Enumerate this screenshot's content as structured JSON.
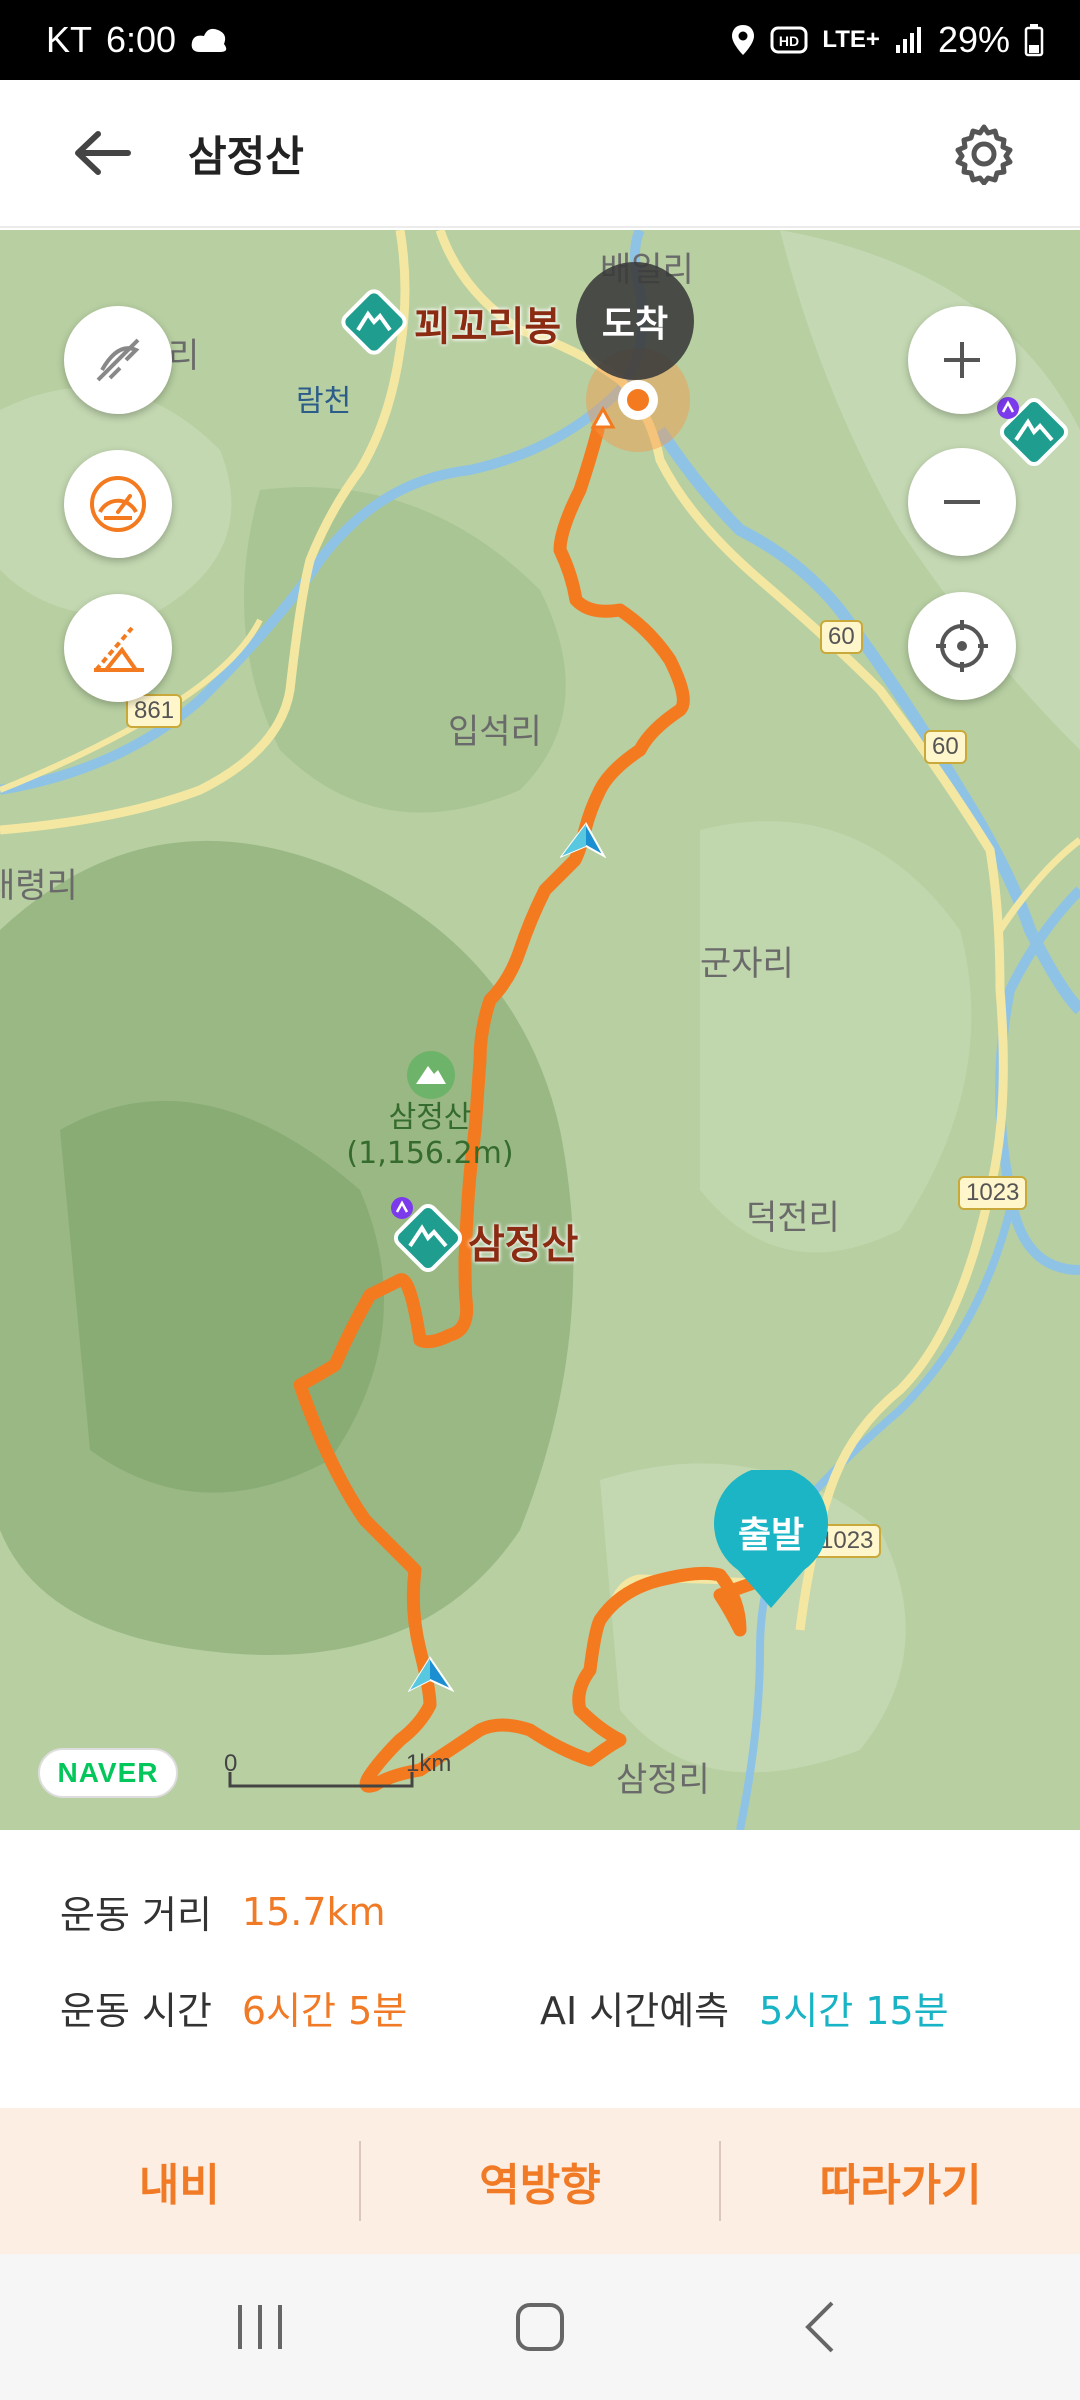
{
  "status_bar": {
    "carrier": "KT",
    "time": "6:00",
    "network": "LTE+",
    "battery": "29%",
    "icons": [
      "cloud-icon",
      "location-icon",
      "hd-icon",
      "lte-icon",
      "signal-icon",
      "battery-icon"
    ]
  },
  "header": {
    "title": "삼정산",
    "back_icon": "back-arrow-icon",
    "settings_icon": "gear-icon"
  },
  "map": {
    "place_labels": [
      "배일리",
      "람천",
      "입석리",
      "군자리",
      "덕전리",
      "삼정리",
      "대령리",
      "리"
    ],
    "road_numbers": [
      "861",
      "60",
      "60",
      "1023",
      "1023"
    ],
    "peak": {
      "name": "삼정산",
      "elevation": "(1,156.2m)"
    },
    "pois": [
      "꾀꼬리봉",
      "삼정산"
    ],
    "arrival_label": "도착",
    "start_label": "출발",
    "scale": {
      "zero": "0",
      "unit": "1km"
    },
    "logo": "NAVER",
    "left_controls": [
      "route-off-icon",
      "speed-gauge-icon",
      "elevation-icon"
    ],
    "right_controls": [
      "zoom-in-icon",
      "zoom-out-icon",
      "locate-icon"
    ],
    "colors": {
      "route": "#f47a20",
      "start": "#1bb5c6",
      "arrive": "#444444"
    }
  },
  "info": {
    "distance_label": "운동 거리",
    "distance_value": "15.7km",
    "time_label": "운동 시간",
    "time_value": "6시간 5분",
    "ai_label": "AI 시간예측",
    "ai_value": "5시간 15분"
  },
  "actions": {
    "navi": "내비",
    "reverse": "역방향",
    "follow": "따라가기"
  },
  "nav_bar": [
    "recent-apps-icon",
    "home-icon",
    "back-icon"
  ]
}
